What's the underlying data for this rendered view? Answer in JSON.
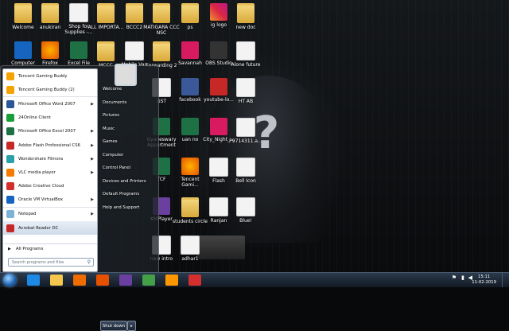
{
  "desktop": {
    "icons": [
      {
        "label": "Welcome",
        "kind": "folder"
      },
      {
        "label": "anukiran",
        "kind": "folder"
      },
      {
        "label": "Shop for Supplies -...",
        "kind": "printer"
      },
      {
        "label": "ALL IMPORTA...",
        "kind": "folder"
      },
      {
        "label": "BCCC2",
        "kind": "folder"
      },
      {
        "label": "MATIGARA CCC NSC",
        "kind": "folder"
      },
      {
        "label": "ps",
        "kind": "folder"
      },
      {
        "label": "ig logo",
        "kind": "instagram"
      },
      {
        "label": "new doc",
        "kind": "folder"
      },
      {
        "label": "Computer",
        "kind": "computer"
      },
      {
        "label": "Firefox",
        "kind": "firefox"
      },
      {
        "label": "Excel File",
        "kind": "excel"
      },
      {
        "label": "MCCC",
        "kind": "folder"
      },
      {
        "label": "Mobile Van",
        "kind": "doc"
      },
      {
        "label": "Forwarding 2",
        "kind": "folder"
      },
      {
        "label": "Savannah",
        "kind": "mp3"
      },
      {
        "label": "OBS Studio",
        "kind": "obs"
      },
      {
        "label": "Alone future",
        "kind": "doc"
      },
      {
        "label": "GST",
        "kind": "doc"
      },
      {
        "label": "facebook",
        "kind": "facebook"
      },
      {
        "label": "youtube-lo...",
        "kind": "youtube"
      },
      {
        "label": "HT AB",
        "kind": "doc"
      },
      {
        "label": "Gyaneswary Appartment",
        "kind": "excel"
      },
      {
        "label": "uan no",
        "kind": "excel"
      },
      {
        "label": "City_Night_...",
        "kind": "mp3"
      },
      {
        "label": "P9714311.a...",
        "kind": "doc"
      },
      {
        "label": "TCF",
        "kind": "excel"
      },
      {
        "label": "Tencent Gami...",
        "kind": "tencent"
      },
      {
        "label": "Flash",
        "kind": "doc"
      },
      {
        "label": "Bell Icon",
        "kind": "doc"
      },
      {
        "label": "KMPlayer",
        "kind": "kmp"
      },
      {
        "label": "students circle",
        "kind": "folder"
      },
      {
        "label": "Ranjan",
        "kind": "doc"
      },
      {
        "label": "Blue!",
        "kind": "doc"
      },
      {
        "label": "new intro",
        "kind": "doc"
      },
      {
        "label": "adhar1",
        "kind": "doc"
      }
    ]
  },
  "start_menu": {
    "programs": [
      {
        "label": "Tencent Gaming Buddy",
        "icon": "tencent-icon",
        "color": "#f4a300",
        "arrow": false
      },
      {
        "label": "Tencent Gaming Buddy (2)",
        "icon": "tencent-icon",
        "color": "#f4a300",
        "arrow": false
      },
      {
        "label": "Microsoft Office Word 2007",
        "icon": "word-icon",
        "color": "#2b5797",
        "arrow": true
      },
      {
        "label": "24Online Client",
        "icon": "24online-icon",
        "color": "#1a9e3a",
        "arrow": false
      },
      {
        "label": "Microsoft Office Excel 2007",
        "icon": "excel-icon",
        "color": "#1e7145",
        "arrow": true
      },
      {
        "label": "Adobe Flash Professional CS6",
        "icon": "flash-icon",
        "color": "#c62828",
        "arrow": true
      },
      {
        "label": "Wondershare Filmora",
        "icon": "filmora-icon",
        "color": "#2aa1a8",
        "arrow": true
      },
      {
        "label": "VLC media player",
        "icon": "vlc-icon",
        "color": "#f57c00",
        "arrow": true
      },
      {
        "label": "Adobe Creative Cloud",
        "icon": "creative-cloud-icon",
        "color": "#d32f2f",
        "arrow": false
      },
      {
        "label": "Oracle VM VirtualBox",
        "icon": "virtualbox-icon",
        "color": "#1565c0",
        "arrow": true
      },
      {
        "label": "Notepad",
        "icon": "notepad-icon",
        "color": "#7fb3d5",
        "arrow": true
      },
      {
        "label": "Acrobat Reader DC",
        "icon": "acrobat-icon",
        "color": "#c62828",
        "arrow": false
      }
    ],
    "all_programs": "All Programs",
    "search_placeholder": "Search programs and files",
    "right_items": [
      "Welcome",
      "Documents",
      "Pictures",
      "Music",
      "Games",
      "Computer",
      "Control Panel",
      "Devices and Printers",
      "Default Programs",
      "Help and Support"
    ],
    "shutdown": "Shut down"
  },
  "taskbar": {
    "pinned": [
      {
        "name": "ie-icon",
        "color": "#1e88e5"
      },
      {
        "name": "explorer-icon",
        "color": "#f3c64e"
      },
      {
        "name": "media-player-icon",
        "color": "#ef6c00"
      },
      {
        "name": "firefox-icon",
        "color": "#e65100"
      },
      {
        "name": "visual-studio-icon",
        "color": "#6a3fa0"
      },
      {
        "name": "chrome-icon",
        "color": "#43a047"
      },
      {
        "name": "firefox-icon-2",
        "color": "#ff9800"
      },
      {
        "name": "creative-cloud-icon",
        "color": "#d32f2f"
      }
    ],
    "time": "15:11",
    "date": "11-02-2019"
  }
}
